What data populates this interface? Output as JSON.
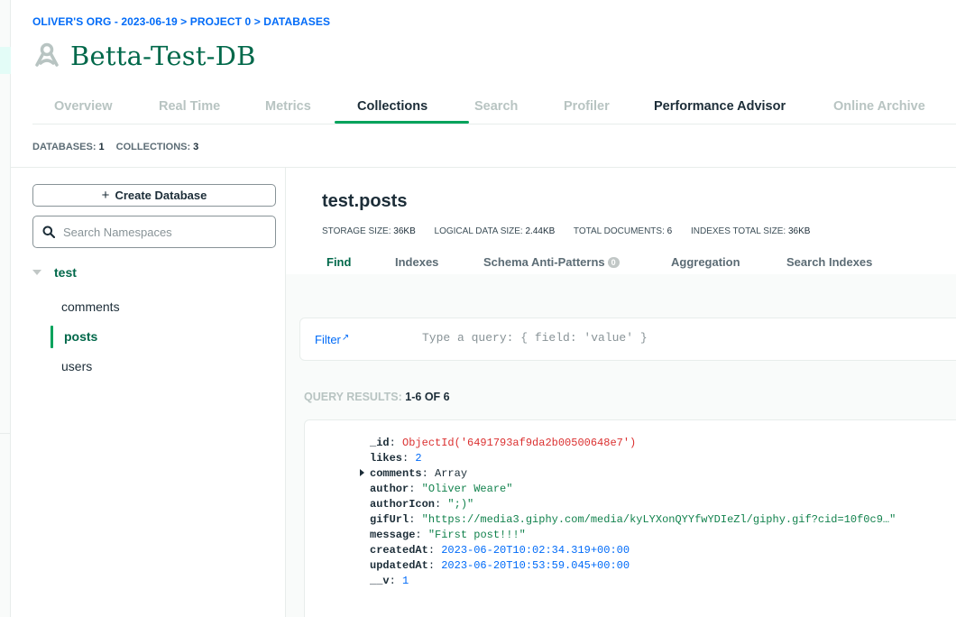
{
  "breadcrumb": "OLIVER'S ORG - 2023-06-19 > PROJECT 0 > DATABASES",
  "cluster_name": "Betta-Test-DB",
  "tabs": [
    "Overview",
    "Real Time",
    "Metrics",
    "Collections",
    "Search",
    "Profiler",
    "Performance Advisor",
    "Online Archive"
  ],
  "active_tab": "Collections",
  "counts": {
    "databases_label": "DATABASES:",
    "databases_value": "1",
    "collections_label": "COLLECTIONS:",
    "collections_value": "3"
  },
  "sidebar": {
    "create_db_label": "Create Database",
    "search_placeholder": "Search Namespaces",
    "database": "test",
    "collections": [
      "comments",
      "posts",
      "users"
    ],
    "active_collection": "posts"
  },
  "main": {
    "namespace": "test.posts",
    "stats": {
      "storage_label": "STORAGE SIZE:",
      "storage_value": "36KB",
      "logical_label": "LOGICAL DATA SIZE:",
      "logical_value": "2.44KB",
      "docs_label": "TOTAL DOCUMENTS:",
      "docs_value": "6",
      "indexes_label": "INDEXES TOTAL SIZE:",
      "indexes_value": "36KB"
    },
    "subtabs": [
      "Find",
      "Indexes",
      "Schema Anti-Patterns",
      "Aggregation",
      "Search Indexes"
    ],
    "schema_badge": "0",
    "filter_label": "Filter",
    "filter_placeholder": "Type a query: { field: 'value' }",
    "results_label": "QUERY RESULTS:",
    "results_range": "1-6 OF 6",
    "document": [
      {
        "key": "_id",
        "value": "ObjectId('6491793af9da2b00500648e7')",
        "type": "oid"
      },
      {
        "key": "likes",
        "value": "2",
        "type": "num"
      },
      {
        "key": "comments",
        "value": "Array",
        "type": "arr"
      },
      {
        "key": "author",
        "value": "\"Oliver Weare\"",
        "type": "str"
      },
      {
        "key": "authorIcon",
        "value": "\";)\"",
        "type": "str"
      },
      {
        "key": "gifUrl",
        "value": "\"https://media3.giphy.com/media/kyLYXonQYYfwYDIeZl/giphy.gif?cid=10f0c9…\"",
        "type": "str"
      },
      {
        "key": "message",
        "value": "\"First post!!!\"",
        "type": "str"
      },
      {
        "key": "createdAt",
        "value": "2023-06-20T10:02:34.319+00:00",
        "type": "num"
      },
      {
        "key": "updatedAt",
        "value": "2023-06-20T10:53:59.045+00:00",
        "type": "num"
      },
      {
        "key": "__v",
        "value": "1",
        "type": "num"
      }
    ]
  },
  "colors": {
    "brand_green": "#00684a",
    "accent_green": "#00a35c",
    "link_blue": "#016bf8"
  }
}
